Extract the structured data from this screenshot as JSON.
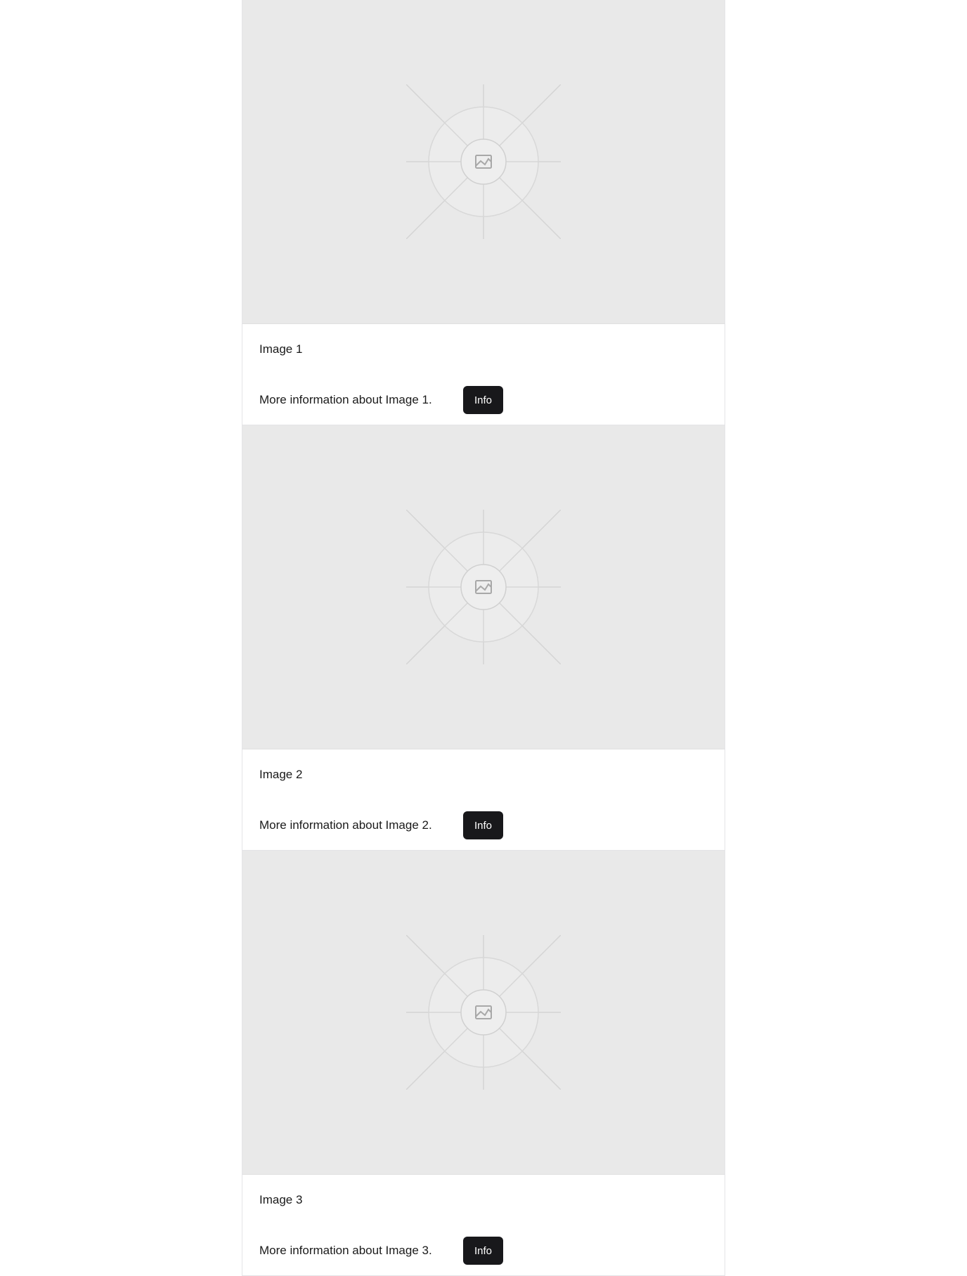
{
  "cards": [
    {
      "title": "Image 1",
      "description": "More information about Image 1.",
      "button_label": "Info",
      "media_icon": "image-placeholder-icon"
    },
    {
      "title": "Image 2",
      "description": "More information about Image 2.",
      "button_label": "Info",
      "media_icon": "image-placeholder-icon"
    },
    {
      "title": "Image 3",
      "description": "More information about Image 3.",
      "button_label": "Info",
      "media_icon": "image-placeholder-icon"
    }
  ],
  "colors": {
    "media_background": "#e9e9e9",
    "button_background": "#18181b",
    "button_text": "#ffffff"
  }
}
